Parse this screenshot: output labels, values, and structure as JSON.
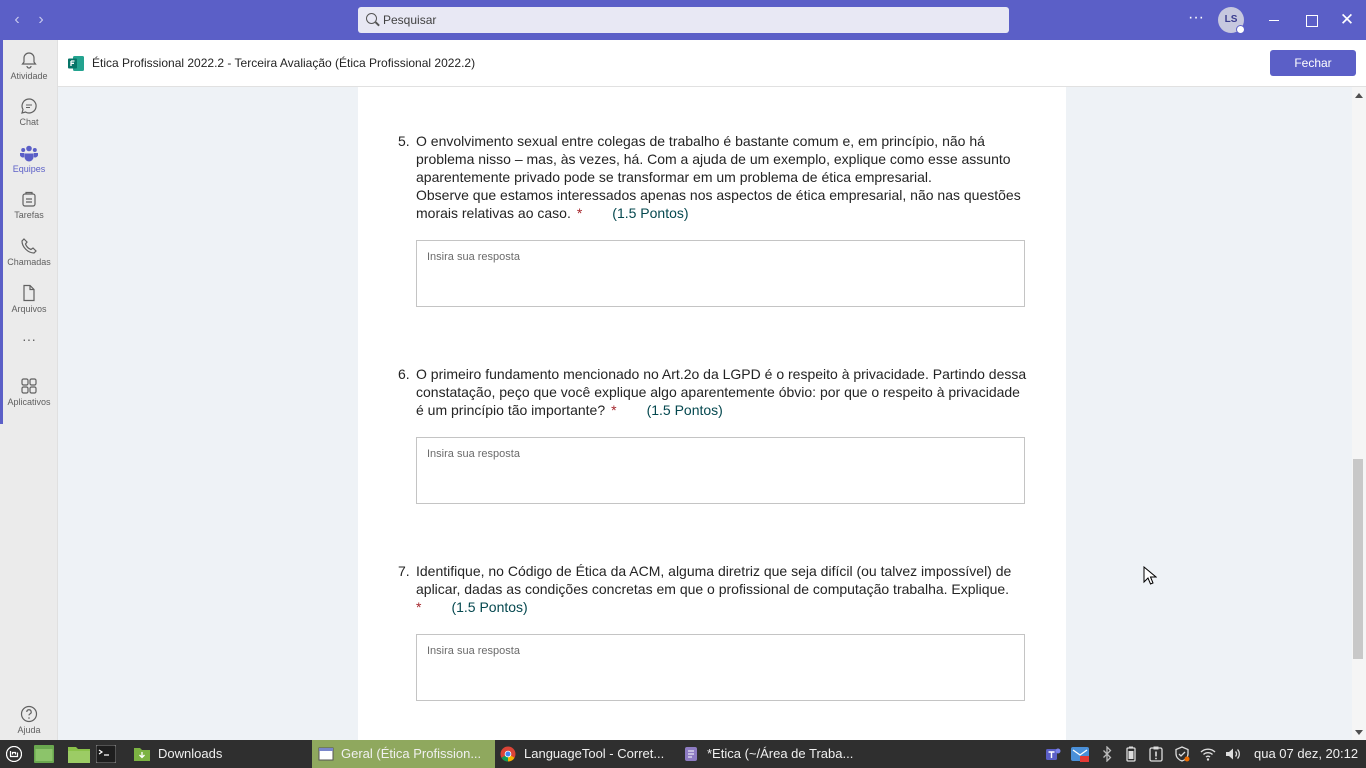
{
  "titlebar": {
    "search_placeholder": "Pesquisar",
    "avatar_initials": "LS",
    "accent_color": "#5b5fc7"
  },
  "rail": {
    "items": [
      {
        "label": "Atividade",
        "icon": "bell-icon"
      },
      {
        "label": "Chat",
        "icon": "chat-icon"
      },
      {
        "label": "Equipes",
        "icon": "teams-icon"
      },
      {
        "label": "Tarefas",
        "icon": "tasks-icon"
      },
      {
        "label": "Chamadas",
        "icon": "phone-icon"
      },
      {
        "label": "Arquivos",
        "icon": "file-icon"
      },
      {
        "label": "Aplicativos",
        "icon": "apps-icon"
      },
      {
        "label": "Ajuda",
        "icon": "help-icon"
      }
    ],
    "more_label": "···"
  },
  "header": {
    "title": "Ética Profissional 2022.2 - Terceira Avaliação (Ética Profissional 2022.2)",
    "close_label": "Fechar"
  },
  "form": {
    "questions": [
      {
        "number": "5.",
        "text": "O envolvimento sexual entre colegas de trabalho é bastante comum e, em princípio, não há problema nisso – mas, às vezes, há. Com a ajuda de um exemplo, explique como esse assunto aparentemente privado pode se transformar em um problema de ética empresarial.",
        "text2": "Observe que estamos interessados apenas nos aspectos de ética empresarial, não nas questões morais relativas ao caso.",
        "required": "*",
        "points": "(1.5 Pontos)",
        "placeholder": "Insira sua resposta"
      },
      {
        "number": "6.",
        "text": "O primeiro fundamento mencionado no Art.2o da LGPD é o respeito à privacidade. Partindo dessa constatação, peço que você explique algo aparentemente óbvio: por que o respeito à privacidade é um princípio tão importante?",
        "required": "*",
        "points": "(1.5 Pontos)",
        "placeholder": "Insira sua resposta"
      },
      {
        "number": "7.",
        "text": "Identifique, no Código de Ética da ACM, alguma diretriz que seja difícil (ou talvez impossível) de aplicar, dadas as condições concretas em que o profissional de computação trabalha. Explique.",
        "required": "*",
        "points": "(1.5 Pontos)",
        "placeholder": "Insira sua resposta"
      }
    ]
  },
  "taskbar": {
    "items": [
      {
        "label": "Downloads"
      },
      {
        "label": "Geral (Ética Profission..."
      },
      {
        "label": "LanguageTool - Corret..."
      },
      {
        "label": "*Etica (~/Área de Traba..."
      }
    ],
    "clock": "qua 07 dez, 20:12"
  }
}
